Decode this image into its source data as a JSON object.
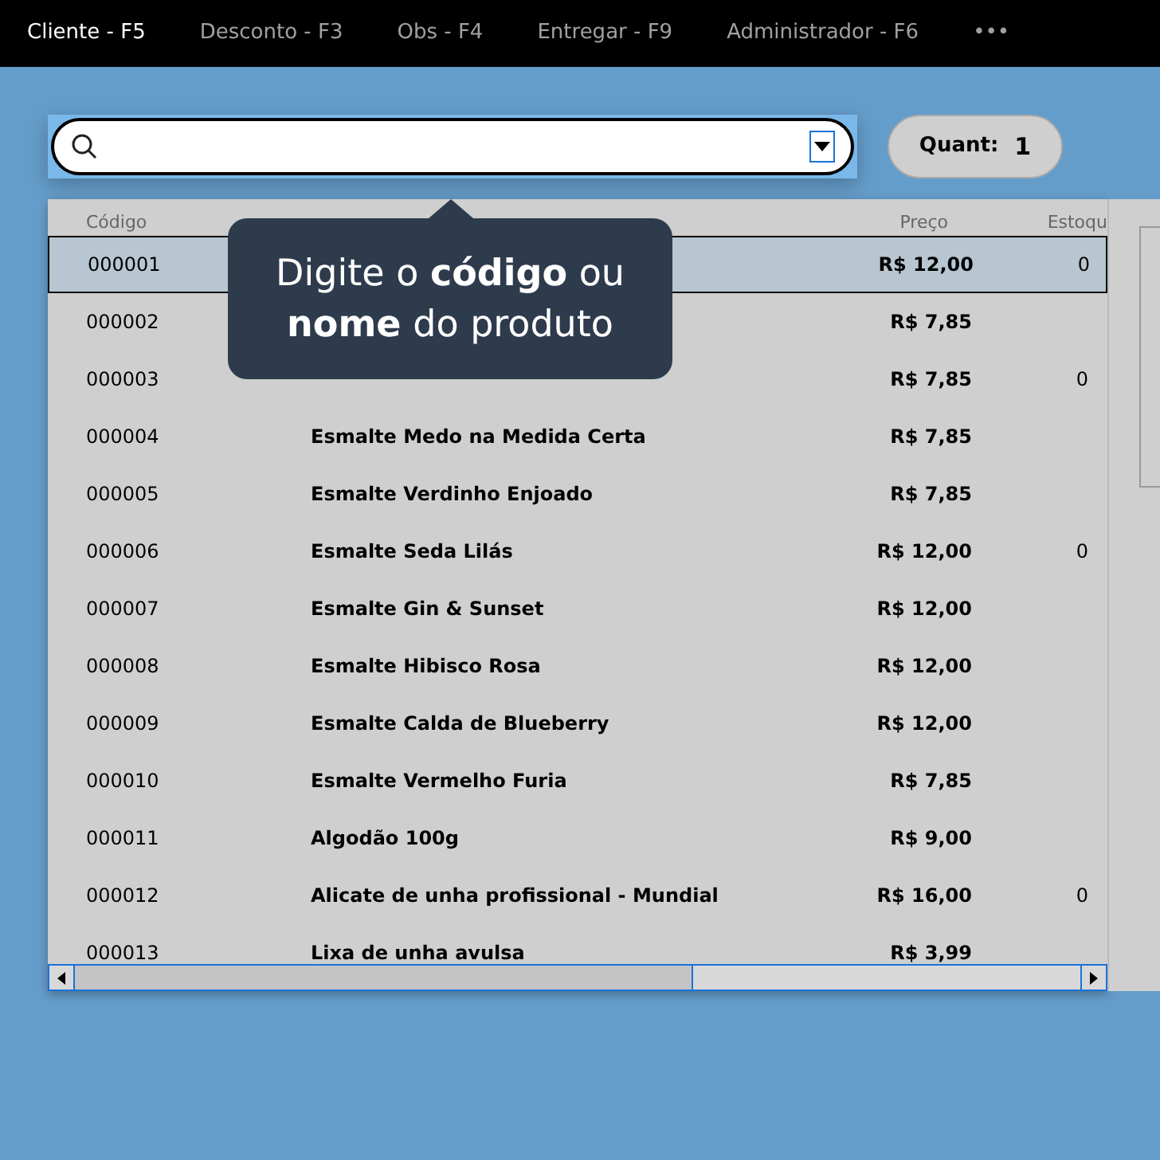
{
  "menu": [
    {
      "label": "Cliente - F5",
      "selected": true
    },
    {
      "label": "Desconto - F3",
      "selected": false
    },
    {
      "label": "Obs - F4",
      "selected": false
    },
    {
      "label": "Entregar - F9",
      "selected": false
    },
    {
      "label": "Administrador - F6",
      "selected": false
    },
    {
      "label": "•••",
      "selected": false
    }
  ],
  "quantity": {
    "label": "Quant:",
    "value": "1"
  },
  "tooltip": "Digite o **código** ou **nome** do produto",
  "table": {
    "columns": [
      "Código",
      "",
      "Preço",
      "Estoqu"
    ],
    "rows": [
      {
        "code": "000001",
        "price": "R$ 12,00",
        "stock": "0",
        "selected": true
      },
      {
        "code": "000002",
        "price": "R$ 7,85",
        "selected": false
      },
      {
        "code": "000003",
        "price": "R$ 7,85",
        "stock": "0",
        "selected": false
      },
      {
        "code": "000004",
        "description": "Esmalte Medo na Medida Certa",
        "price": "R$ 7,85",
        "selected": false
      },
      {
        "code": "000005",
        "description": "Esmalte Verdinho Enjoado",
        "price": "R$ 7,85",
        "selected": false
      },
      {
        "code": "000006",
        "description": "Esmalte Seda Lilás",
        "price": "R$ 12,00",
        "stock": "0",
        "selected": false
      },
      {
        "code": "000007",
        "description": "Esmalte Gin & Sunset",
        "price": "R$ 12,00",
        "selected": false
      },
      {
        "code": "000008",
        "description": "Esmalte Hibisco Rosa",
        "price": "R$ 12,00",
        "selected": false
      },
      {
        "code": "000009",
        "description": "Esmalte Calda de Blueberry",
        "price": "R$ 12,00",
        "selected": false
      },
      {
        "code": "000010",
        "description": "Esmalte Vermelho Furia",
        "price": "R$ 7,85",
        "selected": false
      },
      {
        "code": "000011",
        "description": "Algodão 100g",
        "price": "R$ 9,00",
        "selected": false
      },
      {
        "code": "000012",
        "description": "Alicate de unha profissional - Mundial",
        "price": "R$ 16,00",
        "stock": "0",
        "selected": false
      },
      {
        "code": "000013",
        "description": "Lixa de unha avulsa",
        "price": "R$ 3,99",
        "selected": false
      }
    ]
  }
}
